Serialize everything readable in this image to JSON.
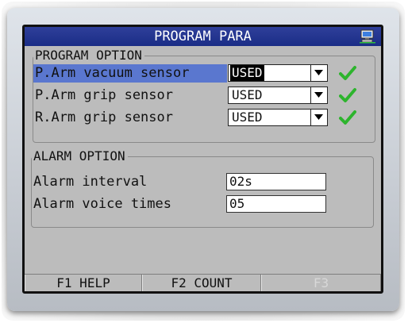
{
  "window": {
    "title": "PROGRAM PARA",
    "icon": "network-computer-icon"
  },
  "program_option": {
    "legend": "PROGRAM OPTION",
    "rows": [
      {
        "label": "P.Arm vacuum sensor",
        "value": "USED",
        "selected": true,
        "status_icon": "green-check-icon"
      },
      {
        "label": "P.Arm grip sensor",
        "value": "USED",
        "selected": false,
        "status_icon": "green-check-icon"
      },
      {
        "label": "R.Arm grip sensor",
        "value": "USED",
        "selected": false,
        "status_icon": "green-check-icon"
      }
    ]
  },
  "alarm_option": {
    "legend": "ALARM OPTION",
    "rows": [
      {
        "label": "Alarm interval",
        "value": "02s"
      },
      {
        "label": "Alarm voice times",
        "value": "05"
      }
    ]
  },
  "function_keys": [
    {
      "label": "F1 HELP",
      "enabled": true
    },
    {
      "label": "F2 COUNT",
      "enabled": true
    },
    {
      "label": "F3",
      "enabled": false
    }
  ],
  "colors": {
    "titlebar": "#1a2d86",
    "selection": "#5a77cf",
    "check": "#2db42d",
    "screen_bg": "#bcbcbc"
  }
}
